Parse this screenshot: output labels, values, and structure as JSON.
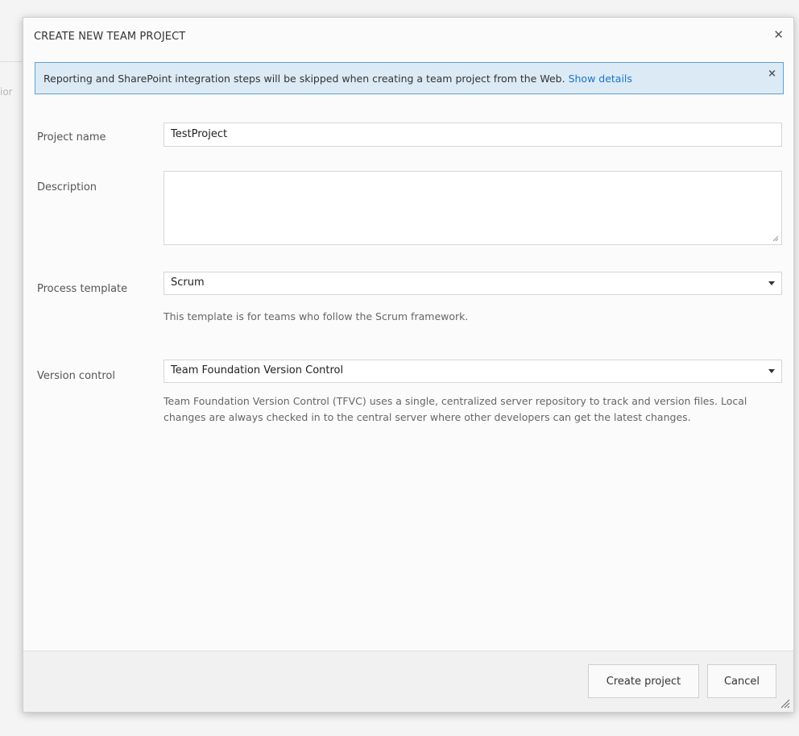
{
  "background": {
    "partial_text": "ior"
  },
  "dialog": {
    "title": "CREATE NEW TEAM PROJECT",
    "close_icon": "close-icon"
  },
  "banner": {
    "message": "Reporting and SharePoint integration steps will be skipped when creating a team project from the Web.",
    "link": "Show details",
    "close_icon": "close-icon"
  },
  "form": {
    "project_name": {
      "label": "Project name",
      "value": "TestProject"
    },
    "description": {
      "label": "Description",
      "value": ""
    },
    "process_template": {
      "label": "Process template",
      "value": "Scrum",
      "help": "This template is for teams who follow the Scrum framework."
    },
    "version_control": {
      "label": "Version control",
      "value": "Team Foundation Version Control",
      "help": "Team Foundation Version Control (TFVC) uses a single, centralized server repository to track and version files. Local changes are always checked in to the central server where other developers can get the latest changes."
    }
  },
  "footer": {
    "create_label": "Create project",
    "cancel_label": "Cancel"
  },
  "colors": {
    "banner_bg": "#dceaf6",
    "banner_border": "#5fa0d4",
    "link": "#1a74c9"
  }
}
